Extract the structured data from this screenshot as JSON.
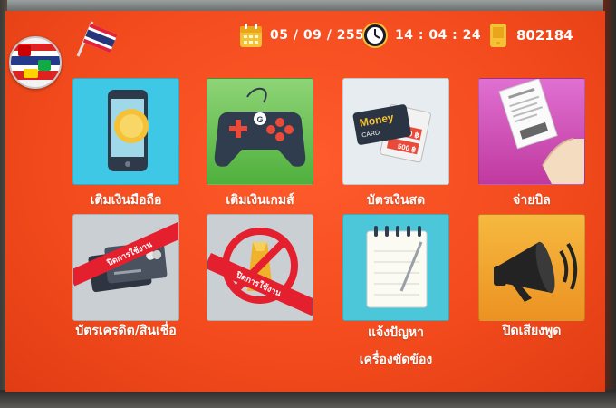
{
  "header": {
    "date": "05 / 09 / 2559",
    "time": "14 : 04 : 24",
    "terminal_code": "802184"
  },
  "icons": {
    "language": "globe-flags-icon",
    "flag": "thai-flag-icon",
    "calendar": "calendar-icon",
    "clock": "clock-icon",
    "phone": "phone-icon"
  },
  "menu": {
    "mobile_topup": {
      "label": "เติมเงินมือถือ",
      "disabled": false
    },
    "game_topup": {
      "label": "เติมเงินเกมส์",
      "disabled": false
    },
    "cash_card": {
      "label": "บัตรเงินสด",
      "disabled": false,
      "card_text": "Money",
      "card_sub": "CARD",
      "amount_a": "300 ฿",
      "amount_b": "500 ฿"
    },
    "pay_bill": {
      "label": "จ่ายบิล",
      "disabled": false
    },
    "credit_card": {
      "label": "บัตรเครดิต/สินเชื่อ",
      "disabled": true,
      "ribbon": "ปิดการใช้งาน"
    },
    "gold": {
      "label": "",
      "disabled": true,
      "ribbon": "ปิดการใช้งาน"
    },
    "report_problem": {
      "label_line1": "แจ้งปัญหา",
      "label_line2": "เครื่องขัดข้อง",
      "disabled": false
    },
    "mute": {
      "label": "ปิดเสียงพูด",
      "disabled": false
    }
  },
  "colors": {
    "screen_bg": "#f24a1c",
    "mobile_tile": "#3fc8e6",
    "game_tile": "#5fc24a",
    "cash_tile": "#e6ecef",
    "bill_tile": "#d24fbf",
    "credit_tile": "#c9cfd3",
    "gold_tile": "#c9cfd3",
    "report_tile": "#4cc6d9",
    "mute_tile": "#f2a52c",
    "ribbon": "#e5202e"
  }
}
